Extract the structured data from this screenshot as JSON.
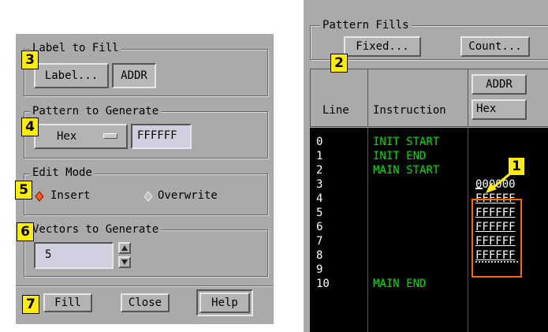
{
  "left_dialog": {
    "label_to_fill": {
      "title": "Label to Fill",
      "label_button": "Label...",
      "label_value": "ADDR"
    },
    "pattern_to_generate": {
      "title": "Pattern to Generate",
      "format": "Hex",
      "value": "FFFFFF"
    },
    "edit_mode": {
      "title": "Edit Mode",
      "insert": "Insert",
      "overwrite": "Overwrite",
      "selected": "Insert"
    },
    "vectors_to_generate": {
      "title": "Vectors to Generate",
      "value": "5"
    },
    "buttons": {
      "fill": "Fill",
      "close": "Close",
      "help": "Help"
    }
  },
  "pattern_fills": {
    "title": "Pattern Fills",
    "fixed": "Fixed...",
    "count": "Count..."
  },
  "table": {
    "headers": {
      "line": "Line",
      "instruction": "Instruction",
      "label": "ADDR",
      "format": "Hex"
    },
    "rows": [
      {
        "line": "0",
        "instruction": "INIT START",
        "value": ""
      },
      {
        "line": "1",
        "instruction": "INIT END",
        "value": ""
      },
      {
        "line": "2",
        "instruction": "MAIN START",
        "value": ""
      },
      {
        "line": "3",
        "instruction": "",
        "value": "000000"
      },
      {
        "line": "4",
        "instruction": "",
        "value": "FFFFFF"
      },
      {
        "line": "5",
        "instruction": "",
        "value": "FFFFFF"
      },
      {
        "line": "6",
        "instruction": "",
        "value": "FFFFFF"
      },
      {
        "line": "7",
        "instruction": "",
        "value": "FFFFFF"
      },
      {
        "line": "8",
        "instruction": "",
        "value": "FFFFFF"
      },
      {
        "line": "9",
        "instruction": "",
        "value": ""
      },
      {
        "line": "10",
        "instruction": "MAIN END",
        "value": ""
      }
    ]
  },
  "callouts": {
    "c1": "1",
    "c2": "2",
    "c3": "3",
    "c4": "4",
    "c5": "5",
    "c6": "6",
    "c7": "7"
  },
  "colors": {
    "panel": "#aaaaaa",
    "callout": "#ffee00",
    "highlight": "#ff6600",
    "screen_text": "#00e000"
  }
}
